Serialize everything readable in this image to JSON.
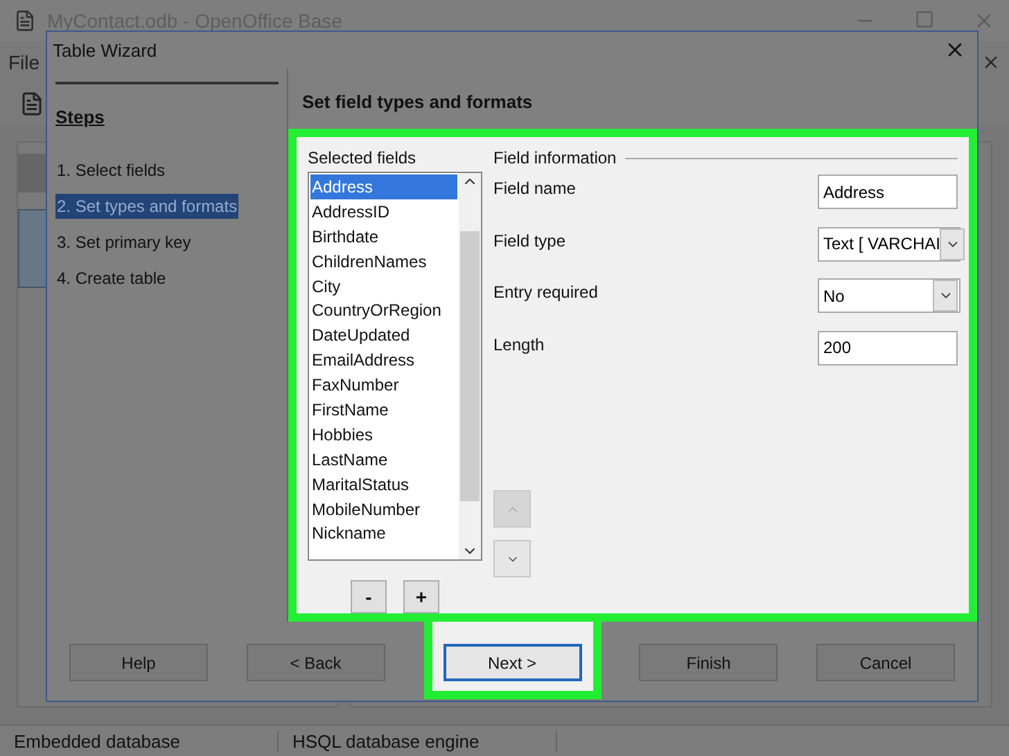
{
  "app": {
    "title": "MyContact.odb - OpenOffice Base",
    "menu": [
      "File"
    ],
    "status_bar": [
      "Embedded database",
      "HSQL database engine"
    ]
  },
  "dialog": {
    "title": "Table Wizard",
    "steps_heading": "Steps",
    "steps": [
      {
        "label": "1. Select fields",
        "selected": false
      },
      {
        "label": "2. Set types and formats",
        "selected": true
      },
      {
        "label": "3. Set primary key",
        "selected": false
      },
      {
        "label": "4. Create table",
        "selected": false
      }
    ],
    "page_title": "Set field types and formats",
    "fields_label": "Selected fields",
    "fields": [
      {
        "name": "Address",
        "selected": true
      },
      {
        "name": "AddressID",
        "selected": false
      },
      {
        "name": "Birthdate",
        "selected": false
      },
      {
        "name": "ChildrenNames",
        "selected": false
      },
      {
        "name": "City",
        "selected": false
      },
      {
        "name": "CountryOrRegion",
        "selected": false
      },
      {
        "name": "DateUpdated",
        "selected": false
      },
      {
        "name": "EmailAddress",
        "selected": false
      },
      {
        "name": "FaxNumber",
        "selected": false
      },
      {
        "name": "FirstName",
        "selected": false
      },
      {
        "name": "Hobbies",
        "selected": false
      },
      {
        "name": "LastName",
        "selected": false
      },
      {
        "name": "MaritalStatus",
        "selected": false
      },
      {
        "name": "MobileNumber",
        "selected": false
      },
      {
        "name": "Nickname",
        "selected": false
      }
    ],
    "remove_button": "-",
    "add_button": "+",
    "info_heading": "Field information",
    "properties": [
      {
        "kind": "text",
        "label": "Field name",
        "value": "Address"
      },
      {
        "kind": "select",
        "label": "Field type",
        "value": "Text [ VARCHAI"
      },
      {
        "kind": "select",
        "label": "Entry required",
        "value": "No"
      },
      {
        "kind": "text",
        "label": "Length",
        "value": "200"
      }
    ],
    "move_up": {
      "disabled": true
    },
    "move_down": {
      "disabled": false
    },
    "buttons": [
      {
        "label": "Help",
        "highlighted": false
      },
      {
        "label": "< Back",
        "highlighted": false
      },
      {
        "label": "Next >",
        "highlighted": true
      },
      {
        "label": "Finish",
        "highlighted": false
      },
      {
        "label": "Cancel",
        "highlighted": false
      }
    ]
  }
}
